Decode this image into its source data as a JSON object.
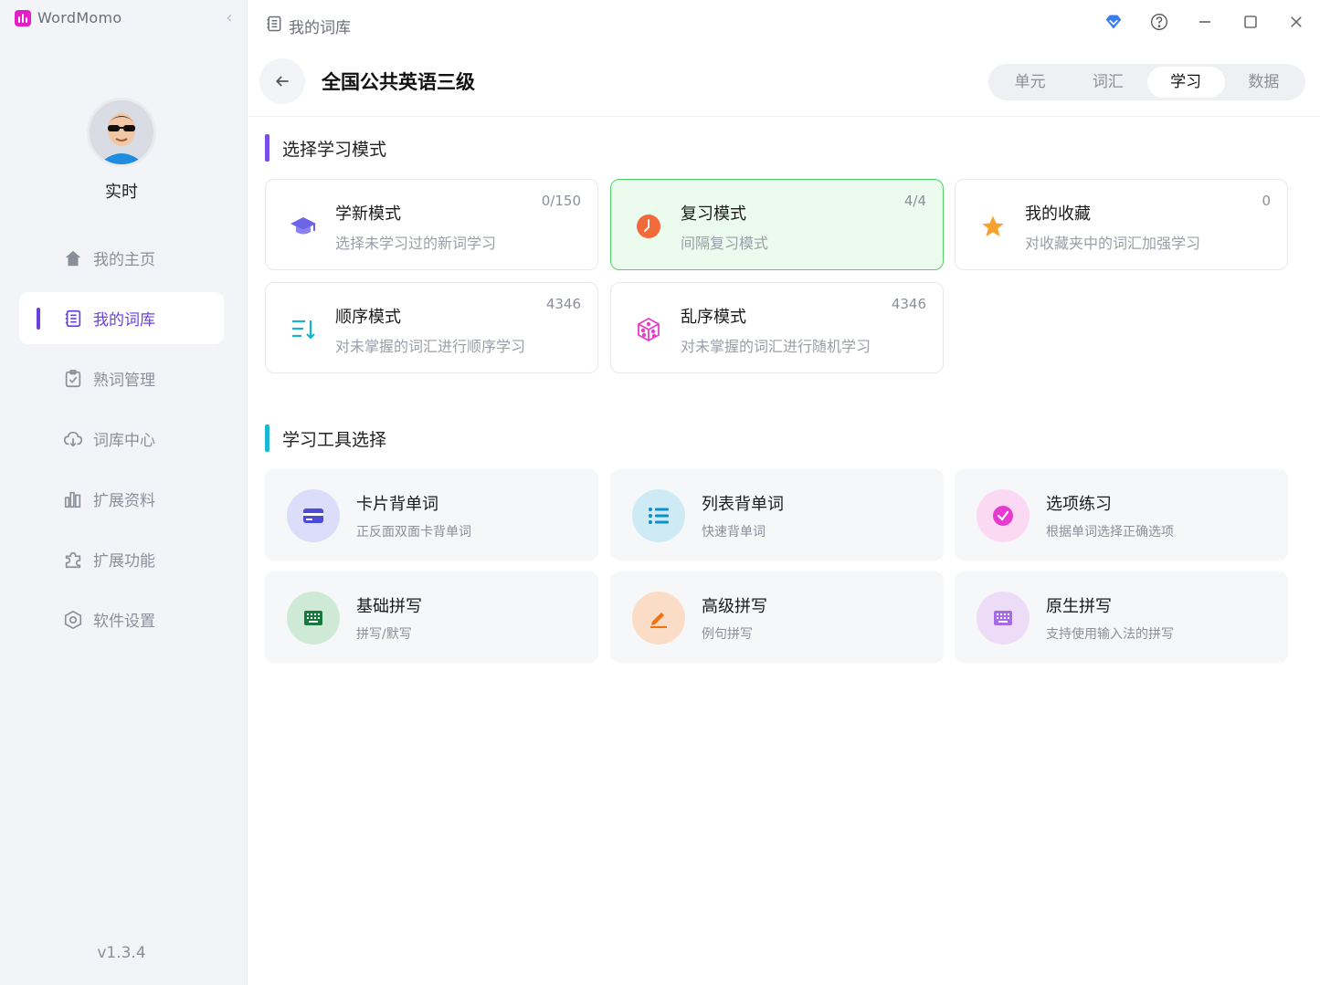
{
  "app": {
    "name": "WordMomo"
  },
  "user": {
    "name": "实时"
  },
  "sidebar": {
    "items": [
      {
        "label": "我的主页"
      },
      {
        "label": "我的词库"
      },
      {
        "label": "熟词管理"
      },
      {
        "label": "词库中心"
      },
      {
        "label": "扩展资料"
      },
      {
        "label": "扩展功能"
      },
      {
        "label": "软件设置"
      }
    ],
    "active_index": 1,
    "version": "v1.3.4"
  },
  "topbar": {
    "breadcrumb": "我的词库"
  },
  "header": {
    "title": "全国公共英语三级",
    "tabs": [
      {
        "label": "单元"
      },
      {
        "label": "词汇"
      },
      {
        "label": "学习"
      },
      {
        "label": "数据"
      }
    ],
    "active_tab": 2
  },
  "sections": {
    "modes_title": "选择学习模式",
    "tools_title": "学习工具选择"
  },
  "modes": [
    {
      "title": "学新模式",
      "subtitle": "选择未学习过的新词学习",
      "count": "0/150",
      "icon": "graduation-cap-icon"
    },
    {
      "title": "复习模式",
      "subtitle": "间隔复习模式",
      "count": "4/4",
      "icon": "clock-icon"
    },
    {
      "title": "我的收藏",
      "subtitle": "对收藏夹中的词汇加强学习",
      "count": "0",
      "icon": "star-icon"
    },
    {
      "title": "顺序模式",
      "subtitle": "对未掌握的词汇进行顺序学习",
      "count": "4346",
      "icon": "sort-icon"
    },
    {
      "title": "乱序模式",
      "subtitle": "对未掌握的词汇进行随机学习",
      "count": "4346",
      "icon": "dice-icon"
    }
  ],
  "tools": [
    {
      "title": "卡片背单词",
      "subtitle": "正反面双面卡背单词",
      "icon": "card-icon"
    },
    {
      "title": "列表背单词",
      "subtitle": "快速背单词",
      "icon": "list-icon"
    },
    {
      "title": "选项练习",
      "subtitle": "根据单词选择正确选项",
      "icon": "check-circle-icon"
    },
    {
      "title": "基础拼写",
      "subtitle": "拼写/默写",
      "icon": "keyboard-icon"
    },
    {
      "title": "高级拼写",
      "subtitle": "例句拼写",
      "icon": "pencil-icon"
    },
    {
      "title": "原生拼写",
      "subtitle": "支持使用输入法的拼写",
      "icon": "keyboard-alt-icon"
    }
  ],
  "colors": {
    "accent": "#6a3fe0",
    "review_highlight_border": "#4ed267",
    "review_highlight_bg": "#ebfbed",
    "section_bar_modes": "#7b4de8",
    "section_bar_tools": "#1bb8d6"
  }
}
